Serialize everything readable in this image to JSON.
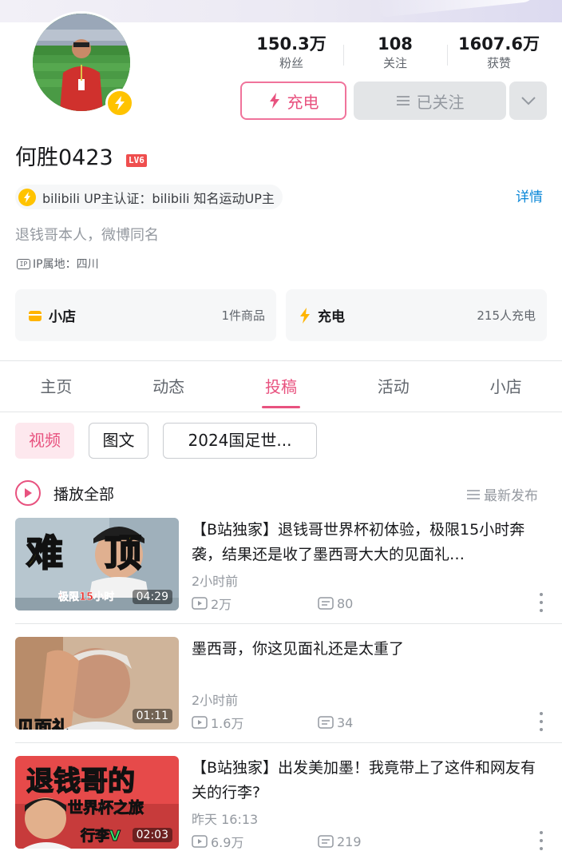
{
  "profile": {
    "name": "何胜0423",
    "level": "LV6",
    "certification": "bilibili UP主认证：bilibili 知名运动UP主",
    "detail_link": "详情",
    "bio": "退钱哥本人，微博同名",
    "ip_label": "IP属地：四川",
    "ip_badge": "IP"
  },
  "stats": [
    {
      "value": "150.3万",
      "label": "粉丝"
    },
    {
      "value": "108",
      "label": "关注"
    },
    {
      "value": "1607.6万",
      "label": "获赞"
    }
  ],
  "actions": {
    "charge_label": "充电",
    "followed_label": "已关注"
  },
  "cards": {
    "shop_title": "小店",
    "shop_info": "1件商品",
    "charge_title": "充电",
    "charge_info": "215人充电"
  },
  "tabs": [
    "主页",
    "动态",
    "投稿",
    "活动",
    "小店"
  ],
  "active_tab": "投稿",
  "filters": [
    "视频",
    "图文",
    "2024国足世..."
  ],
  "playall": {
    "label": "播放全部",
    "sort": "最新发布"
  },
  "videos": [
    {
      "title": "【B站独家】退钱哥世界杯初体验，极限15小时奔袭，结果还是收了墨西哥大大的见面礼…",
      "time": "2小时前",
      "plays": "2万",
      "comments": "80",
      "duration": "04:29",
      "thumb_text_main": "难  顶",
      "thumb_text_sub": "极限15小时"
    },
    {
      "title": "墨西哥，你这见面礼还是太重了",
      "time": "2小时前",
      "plays": "1.6万",
      "comments": "34",
      "duration": "01:11",
      "thumb_text_sub": "见面礼"
    },
    {
      "title": "【B站独家】出发美加墨！我竟带上了这件和网友有关的行李?",
      "time": "昨天 16:13",
      "plays": "6.9万",
      "comments": "219",
      "duration": "02:03",
      "thumb_text_main": "退钱哥的",
      "thumb_text_sub": "世界杯之旅",
      "thumb_text_tag": "行李V"
    }
  ],
  "colors": {
    "brand_pink": "#e8527f",
    "gold": "#ffc300",
    "link_blue": "#0c88d8"
  }
}
